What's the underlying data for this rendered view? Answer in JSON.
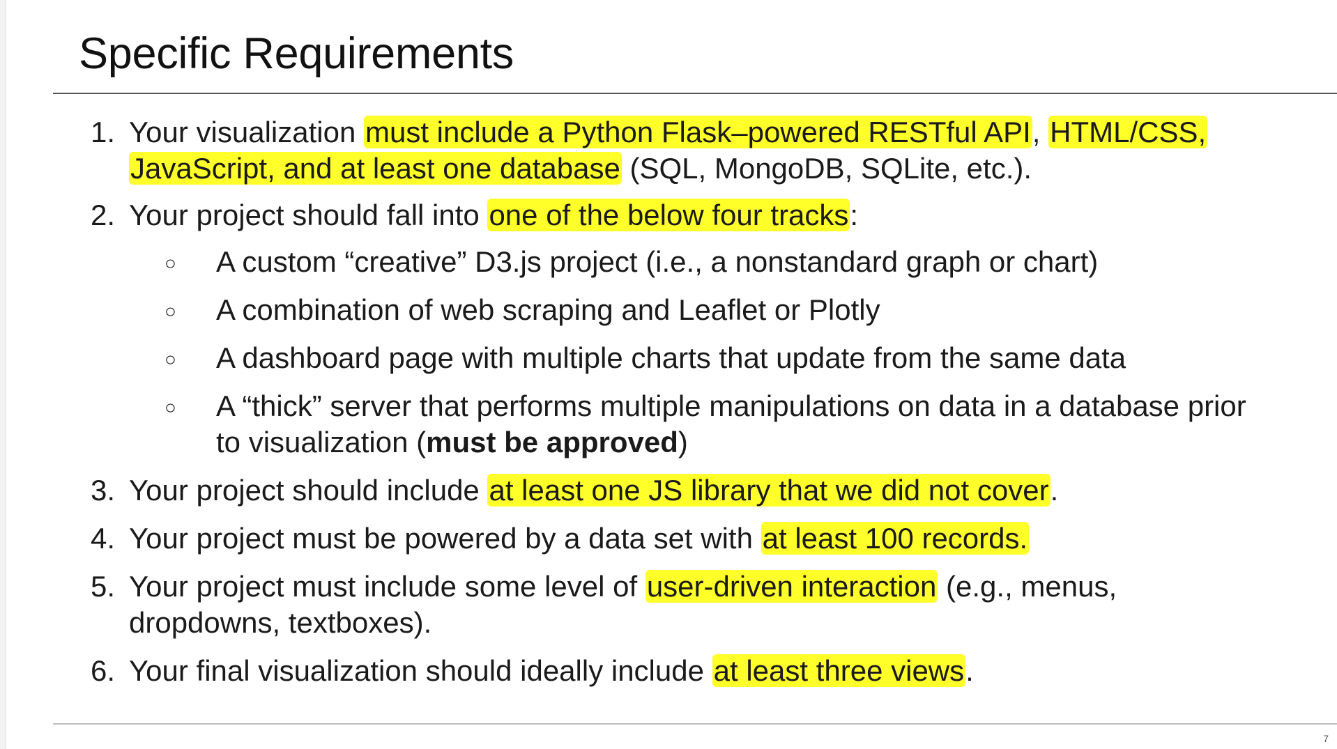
{
  "title": "Specific Requirements",
  "page_number": "7",
  "items": [
    {
      "num": "1.",
      "l1_a": "Your visualization ",
      "l1_hl1": "must include a Python Flask–powered RESTful API",
      "l1_b": ", ",
      "l1_hl2": "HTML/CSS,",
      "l2_hl": "JavaScript, and at least one database",
      "l2_b": " (SQL, MongoDB, SQLite, etc.)."
    },
    {
      "num": "2.",
      "a": "Your project should fall into ",
      "hl": "one of the below four tracks",
      "b": ":",
      "tracks": [
        {
          "bullet": "○",
          "text": "A custom “creative” D3.js project (i.e., a nonstandard graph or chart)"
        },
        {
          "bullet": "○",
          "text": "A combination of web scraping and Leaflet or Plotly"
        },
        {
          "bullet": "○",
          "text": "A dashboard page with multiple charts that update from the same data"
        },
        {
          "bullet": "○",
          "l1": "A “thick” server that performs multiple manipulations on data in a database prior",
          "l2_a": "to visualization (",
          "l2_bold": "must be approved",
          "l2_b": ")"
        }
      ]
    },
    {
      "num": "3.",
      "a": "Your project should include ",
      "hl": "at least one JS library that we did not cover",
      "b": "."
    },
    {
      "num": "4.",
      "a": "Your project must be powered by a data set with ",
      "hl": "at least 100 records.",
      "b": ""
    },
    {
      "num": "5.",
      "a": "Your project must include some level of ",
      "hl": "user-driven interaction",
      "b": " (e.g., menus,",
      "l2": "dropdowns, textboxes)."
    },
    {
      "num": "6.",
      "a": "Your final visualization should ideally include ",
      "hl": "at least three views",
      "b": "."
    }
  ],
  "highlight_color": "#ffff29"
}
